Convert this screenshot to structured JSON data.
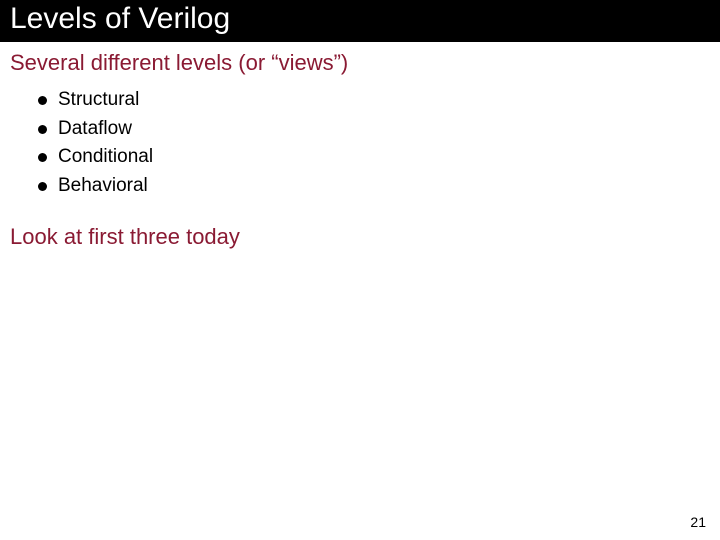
{
  "title": "Levels of Verilog",
  "subheading1": "Several different levels (or “views”)",
  "bullets": {
    "b0": "Structural",
    "b1": "Dataflow",
    "b2": "Conditional",
    "b3": "Behavioral"
  },
  "subheading2": "Look at first three today",
  "page_number": "21"
}
